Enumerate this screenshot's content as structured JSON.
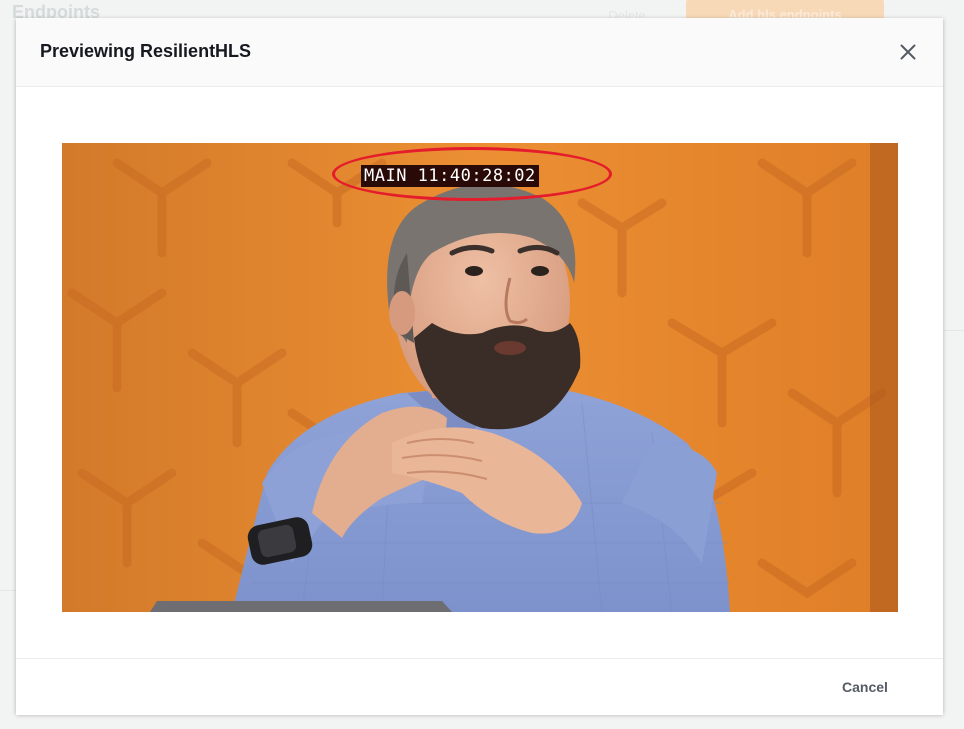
{
  "background": {
    "page_title": "Endpoints",
    "secondary_button_label": "Delete",
    "primary_button_label": "Add hls endpoints"
  },
  "modal": {
    "title": "Previewing ResilientHLS",
    "close_icon": "close-icon",
    "video": {
      "timecode_overlay": "MAIN 11:40:28:02",
      "highlight_color": "#e41c2b"
    },
    "footer": {
      "cancel_label": "Cancel"
    }
  },
  "colors": {
    "modal_background": "#ffffff",
    "header_background": "#fafafa",
    "video_background": "#e3872c",
    "primary_accent": "#ec7211",
    "text_dark": "#16191f",
    "text_muted": "#545b64"
  }
}
